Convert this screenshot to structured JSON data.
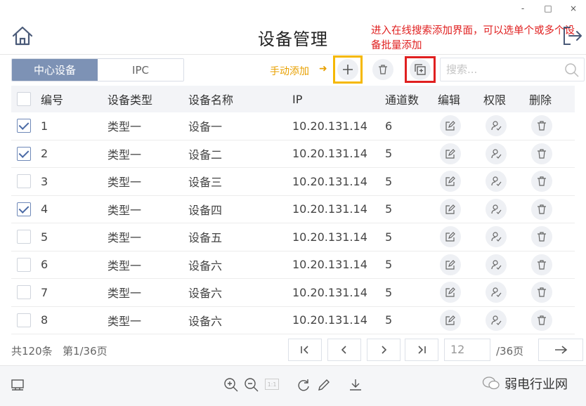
{
  "window": {
    "minimize": "-",
    "maximize": "□",
    "close": "×"
  },
  "header": {
    "title": "设备管理",
    "annotation": "进入在线搜索添加界面，可以选单个或多个设备批量添加"
  },
  "tabs": [
    {
      "label": "中心设备",
      "active": true
    },
    {
      "label": "IPC",
      "active": false
    }
  ],
  "toolbar": {
    "manual_add_annotation": "手动添加",
    "annotation_arrow": "➜",
    "search_placeholder": "搜索..."
  },
  "table": {
    "columns": [
      "编号",
      "设备类型",
      "设备名称",
      "IP",
      "通道数",
      "编辑",
      "权限",
      "删除"
    ],
    "rows": [
      {
        "checked": true,
        "id": "1",
        "type": "类型一",
        "name": "设备一",
        "ip": "10.20.131.14",
        "channels": "6"
      },
      {
        "checked": true,
        "id": "2",
        "type": "类型一",
        "name": "设备二",
        "ip": "10.20.131.14",
        "channels": "5"
      },
      {
        "checked": false,
        "id": "3",
        "type": "类型一",
        "name": "设备三",
        "ip": "10.20.131.14",
        "channels": "5"
      },
      {
        "checked": true,
        "id": "4",
        "type": "类型一",
        "name": "设备四",
        "ip": "10.20.131.14",
        "channels": "5"
      },
      {
        "checked": false,
        "id": "5",
        "type": "类型一",
        "name": "设备五",
        "ip": "10.20.131.14",
        "channels": "5"
      },
      {
        "checked": false,
        "id": "6",
        "type": "类型一",
        "name": "设备六",
        "ip": "10.20.131.14",
        "channels": "5"
      },
      {
        "checked": false,
        "id": "7",
        "type": "类型一",
        "name": "设备六",
        "ip": "10.20.131.14",
        "channels": "5"
      },
      {
        "checked": false,
        "id": "8",
        "type": "类型一",
        "name": "设备六",
        "ip": "10.20.131.14",
        "channels": "5"
      }
    ]
  },
  "pagination": {
    "total": "共120条",
    "current": "第1/36页",
    "first": "|<",
    "prev": "<",
    "next": ">",
    "last": ">|",
    "page_value": "12",
    "page_total": "/36页",
    "go": "→"
  },
  "bottombar": {
    "zoom_badge": "1:1",
    "watermark": "弱电行业网"
  },
  "colors": {
    "accent": "#7d92b5",
    "annotation_red": "#e02020",
    "annotation_yellow": "#f5b800"
  }
}
